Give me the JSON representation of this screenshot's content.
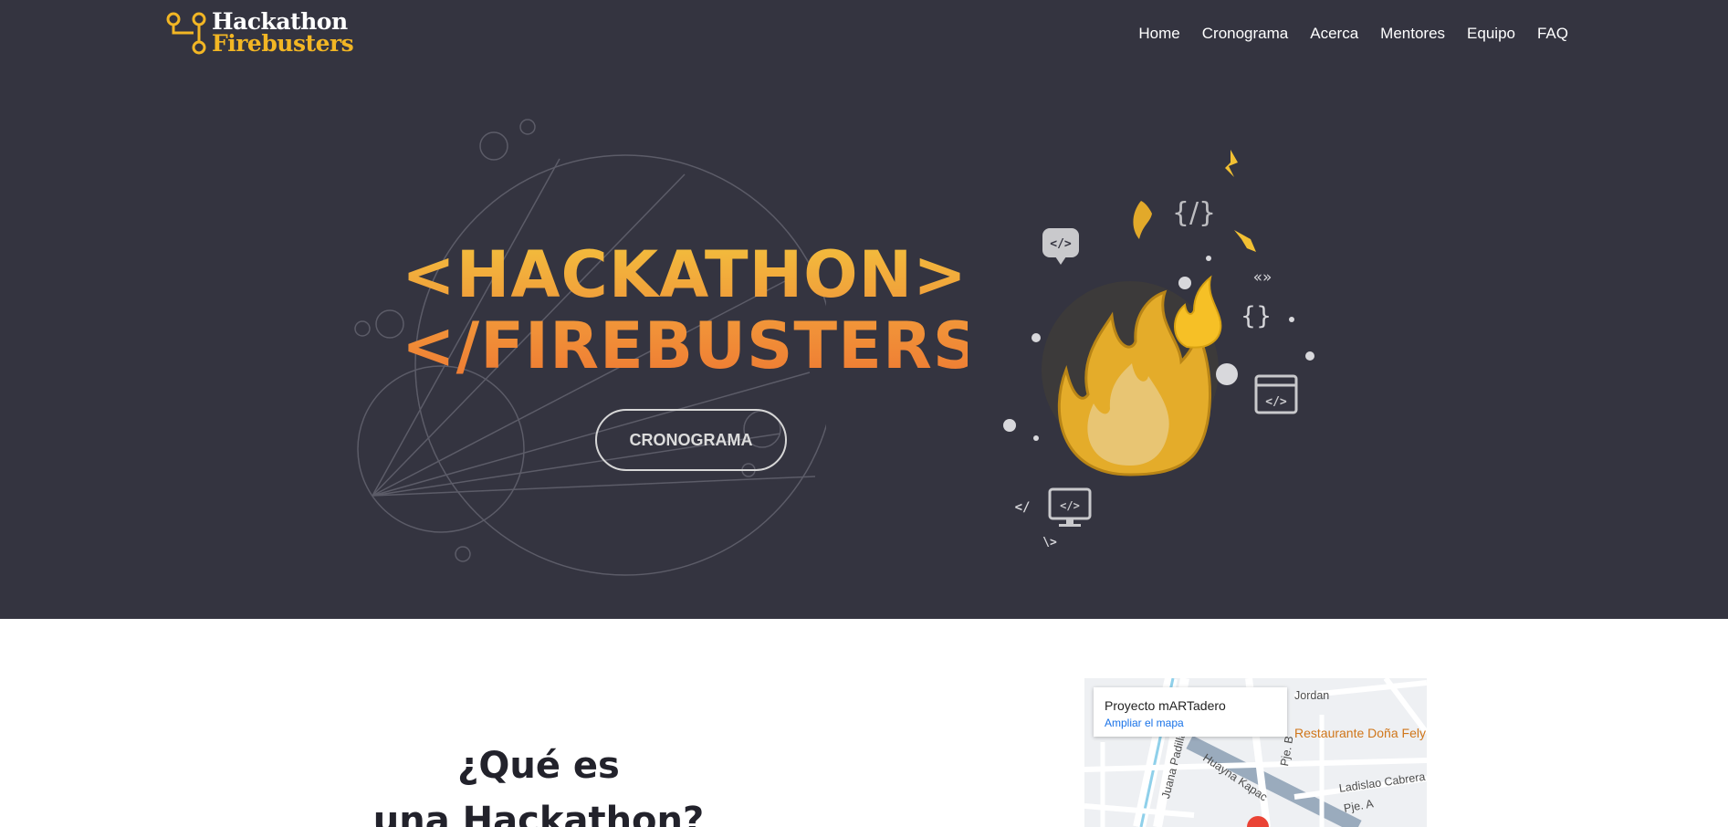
{
  "header": {
    "logo": {
      "line1": "Hackathon",
      "line2": "Firebusters"
    },
    "nav": [
      "Home",
      "Cronograma",
      "Acerca",
      "Mentores",
      "Equipo",
      "FAQ"
    ]
  },
  "hero": {
    "title_line1": "<HACKATHON>",
    "title_line2": "</FIREBUSTERS>",
    "cta_label": "CRONOGRAMA",
    "illustration_tags": [
      "</>",
      "{/}",
      "{}",
      "</",
      "\\>"
    ]
  },
  "about": {
    "title_line1": "¿Qué es",
    "title_line2": "una Hackathon?"
  },
  "map": {
    "place_name": "Proyecto mARTadero",
    "link_label": "Ampliar el mapa",
    "poi_label": "Restaurante Doña Fely C",
    "street_labels": [
      "Jordan",
      "Huayna Kapac",
      "Juana Padilla",
      "Pje. B",
      "Ladislao Cabrera",
      "Pje. A"
    ]
  },
  "colors": {
    "hero_bg": "#343440",
    "accent": "#f2b624",
    "title_top": "#f3bf3d",
    "title_bottom": "#ee7a33"
  },
  "icons": [
    "logo-circuit-icon",
    "flame-icon",
    "chat-code-icon",
    "braces-icon",
    "browser-code-icon",
    "monitor-code-icon"
  ]
}
